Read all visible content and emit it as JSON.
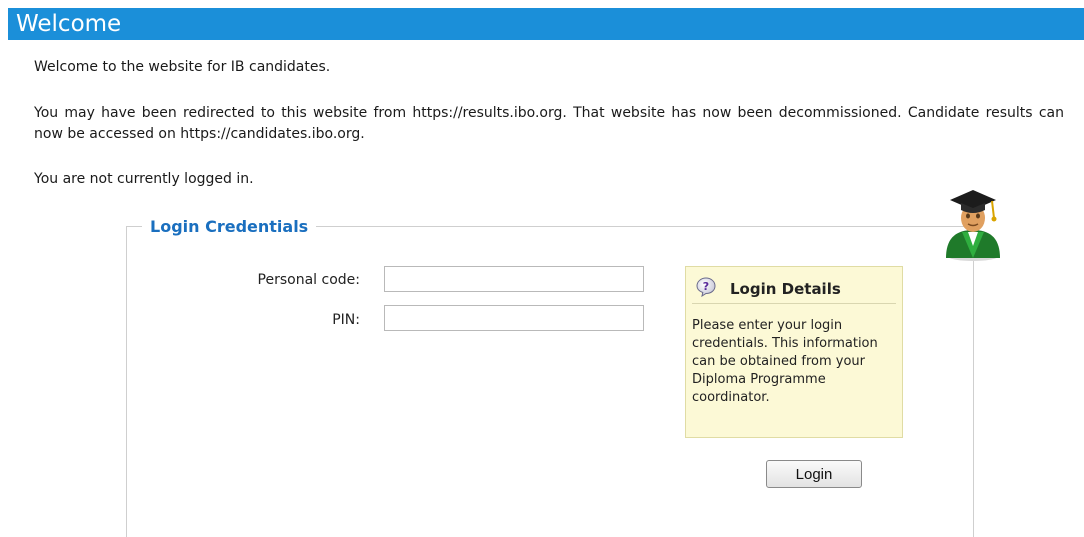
{
  "header": {
    "title": "Welcome"
  },
  "content": {
    "welcome": "Welcome to the website for IB candidates.",
    "redirect": "You may have been redirected to this website from https://results.ibo.org. That website has now been decommissioned. Candidate results can now be accessed on https://candidates.ibo.org.",
    "status": "You are not currently logged in."
  },
  "login": {
    "legend": "Login Credentials",
    "personal_code_label": "Personal code:",
    "personal_code_value": "",
    "pin_label": "PIN:",
    "pin_value": "",
    "button_label": "Login"
  },
  "help": {
    "title": "Login Details",
    "text": "Please enter your login credentials. This information can be obtained from your Diploma Programme coordinator.",
    "icon": "question-icon"
  },
  "colors": {
    "header_bg": "#1b8fd9",
    "legend_text": "#1a6fbf",
    "help_bg": "#fcf9d6"
  }
}
